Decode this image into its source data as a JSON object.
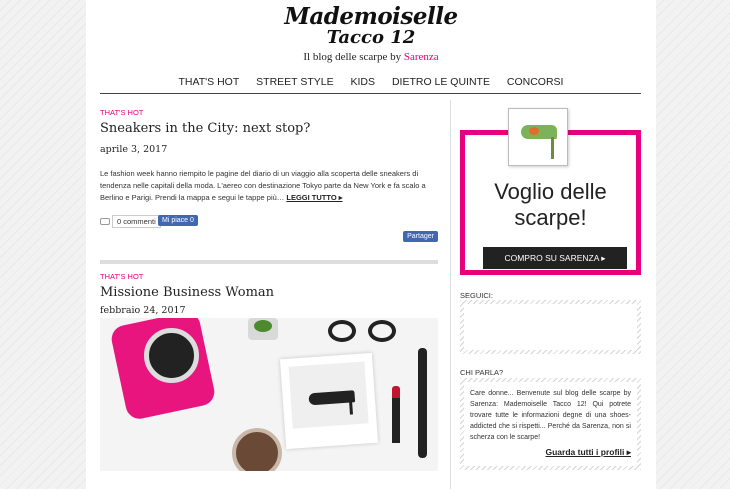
{
  "header": {
    "logo_line1": "Mademoiselle",
    "logo_line2": "Tacco 12",
    "tagline_prefix": "Il blog delle scarpe by ",
    "tagline_brand": "Sarenza"
  },
  "nav": [
    "THAT'S HOT",
    "STREET STYLE",
    "KIDS",
    "DIETRO LE QUINTE",
    "CONCORSI"
  ],
  "posts": [
    {
      "category": "THAT'S HOT",
      "title": "Sneakers in the City: next stop?",
      "date": "aprile 3, 2017",
      "excerpt": "Le fashion week hanno riempito le pagine del diario di un viaggio alla scoperta delle sneakers di tendenza nelle capitali della moda. L'aereo con destinazione Tokyo parte da New York e fa scalo a Berlino e Parigi. Prendi la mappa e segui le tappe più… ",
      "read_more": "LEGGI TUTTO ▸",
      "comments": "0 commenti",
      "like": "Mi piace 0",
      "share": "Partager"
    },
    {
      "category": "THAT'S HOT",
      "title": "Missione Business Woman",
      "date": "febbraio 24, 2017"
    }
  ],
  "sidebar": {
    "ad_headline": "Voglio delle scarpe!",
    "ad_button": "COMPRO SU SARENZA ▸",
    "seguici_title": "SEGUICI:",
    "chi_parla_title": "CHI PARLA?",
    "chi_parla_text": "Care donne... Benvenute sul blog delle scarpe by Sarenza: Mademoiselle Tacco 12! Qui potrete trovare tutte le informazioni degne di una shoes-addicted che si rispetti... Perché da Sarenza, non si scherza con le scarpe!",
    "chi_parla_link": "Guarda tutti i profili ▸"
  },
  "colors": {
    "accent": "#e6007e",
    "facebook": "#4267b2"
  }
}
